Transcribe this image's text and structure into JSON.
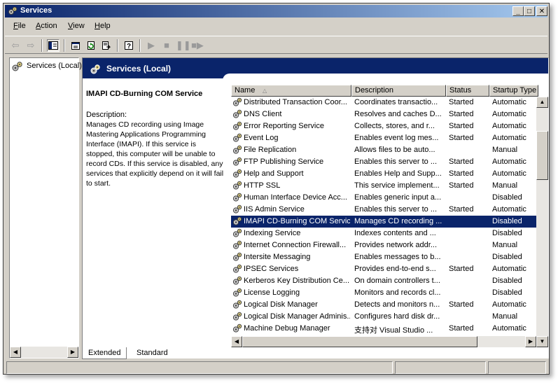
{
  "window": {
    "title": "Services",
    "icon": "gear-services-icon"
  },
  "menu": [
    {
      "label": "File",
      "accel": "F"
    },
    {
      "label": "Action",
      "accel": "A"
    },
    {
      "label": "View",
      "accel": "V"
    },
    {
      "label": "Help",
      "accel": "H"
    }
  ],
  "toolbar": [
    "back-arrow-icon",
    "forward-arrow-icon",
    "show-hide-tree-icon",
    "properties-icon",
    "refresh-icon",
    "export-list-icon",
    "help-icon",
    "start-service-icon",
    "stop-service-icon",
    "pause-service-icon",
    "restart-service-icon"
  ],
  "tree": {
    "root_label": "Services (Local)"
  },
  "header": {
    "title": "Services (Local)"
  },
  "details": {
    "service_name": "IMAPI CD-Burning COM Service",
    "description_label": "Description:",
    "description": "Manages CD recording using Image Mastering Applications Programming Interface (IMAPI). If this service is stopped, this computer will be unable to record CDs. If this service is disabled, any services that explicitly depend on it will fail to start."
  },
  "columns": {
    "name": "Name",
    "description": "Description",
    "status": "Status",
    "startup": "Startup Type"
  },
  "rows": [
    {
      "name": "Distributed Transaction Coor...",
      "description": "Coordinates transactio...",
      "status": "Started",
      "startup": "Automatic"
    },
    {
      "name": "DNS Client",
      "description": "Resolves and caches D...",
      "status": "Started",
      "startup": "Automatic"
    },
    {
      "name": "Error Reporting Service",
      "description": "Collects, stores, and r...",
      "status": "Started",
      "startup": "Automatic"
    },
    {
      "name": "Event Log",
      "description": "Enables event log mes...",
      "status": "Started",
      "startup": "Automatic"
    },
    {
      "name": "File Replication",
      "description": "Allows files to be auto...",
      "status": "",
      "startup": "Manual"
    },
    {
      "name": "FTP Publishing Service",
      "description": "Enables this server to ...",
      "status": "Started",
      "startup": "Automatic"
    },
    {
      "name": "Help and Support",
      "description": "Enables Help and Supp...",
      "status": "Started",
      "startup": "Automatic"
    },
    {
      "name": "HTTP SSL",
      "description": "This service implement...",
      "status": "Started",
      "startup": "Manual"
    },
    {
      "name": "Human Interface Device Acc...",
      "description": "Enables generic input a...",
      "status": "",
      "startup": "Disabled"
    },
    {
      "name": "IIS Admin Service",
      "description": "Enables this server to ...",
      "status": "Started",
      "startup": "Automatic"
    },
    {
      "name": "IMAPI CD-Burning COM Service",
      "description": "Manages CD recording ...",
      "status": "",
      "startup": "Disabled",
      "selected": true
    },
    {
      "name": "Indexing Service",
      "description": "Indexes contents and ...",
      "status": "",
      "startup": "Disabled"
    },
    {
      "name": "Internet Connection Firewall...",
      "description": "Provides network addr...",
      "status": "",
      "startup": "Manual"
    },
    {
      "name": "Intersite Messaging",
      "description": "Enables messages to b...",
      "status": "",
      "startup": "Disabled"
    },
    {
      "name": "IPSEC Services",
      "description": "Provides end-to-end s...",
      "status": "Started",
      "startup": "Automatic"
    },
    {
      "name": "Kerberos Key Distribution Ce...",
      "description": "On domain controllers t...",
      "status": "",
      "startup": "Disabled"
    },
    {
      "name": "License Logging",
      "description": "Monitors and records cl...",
      "status": "",
      "startup": "Disabled"
    },
    {
      "name": "Logical Disk Manager",
      "description": "Detects and monitors n...",
      "status": "Started",
      "startup": "Automatic"
    },
    {
      "name": "Logical Disk Manager Adminis...",
      "description": "Configures hard disk dr...",
      "status": "",
      "startup": "Manual"
    },
    {
      "name": "Machine Debug Manager",
      "description": "支持对 Visual Studio ...",
      "status": "Started",
      "startup": "Automatic"
    }
  ],
  "tabs": [
    {
      "label": "Extended",
      "active": true
    },
    {
      "label": "Standard",
      "active": false
    }
  ]
}
